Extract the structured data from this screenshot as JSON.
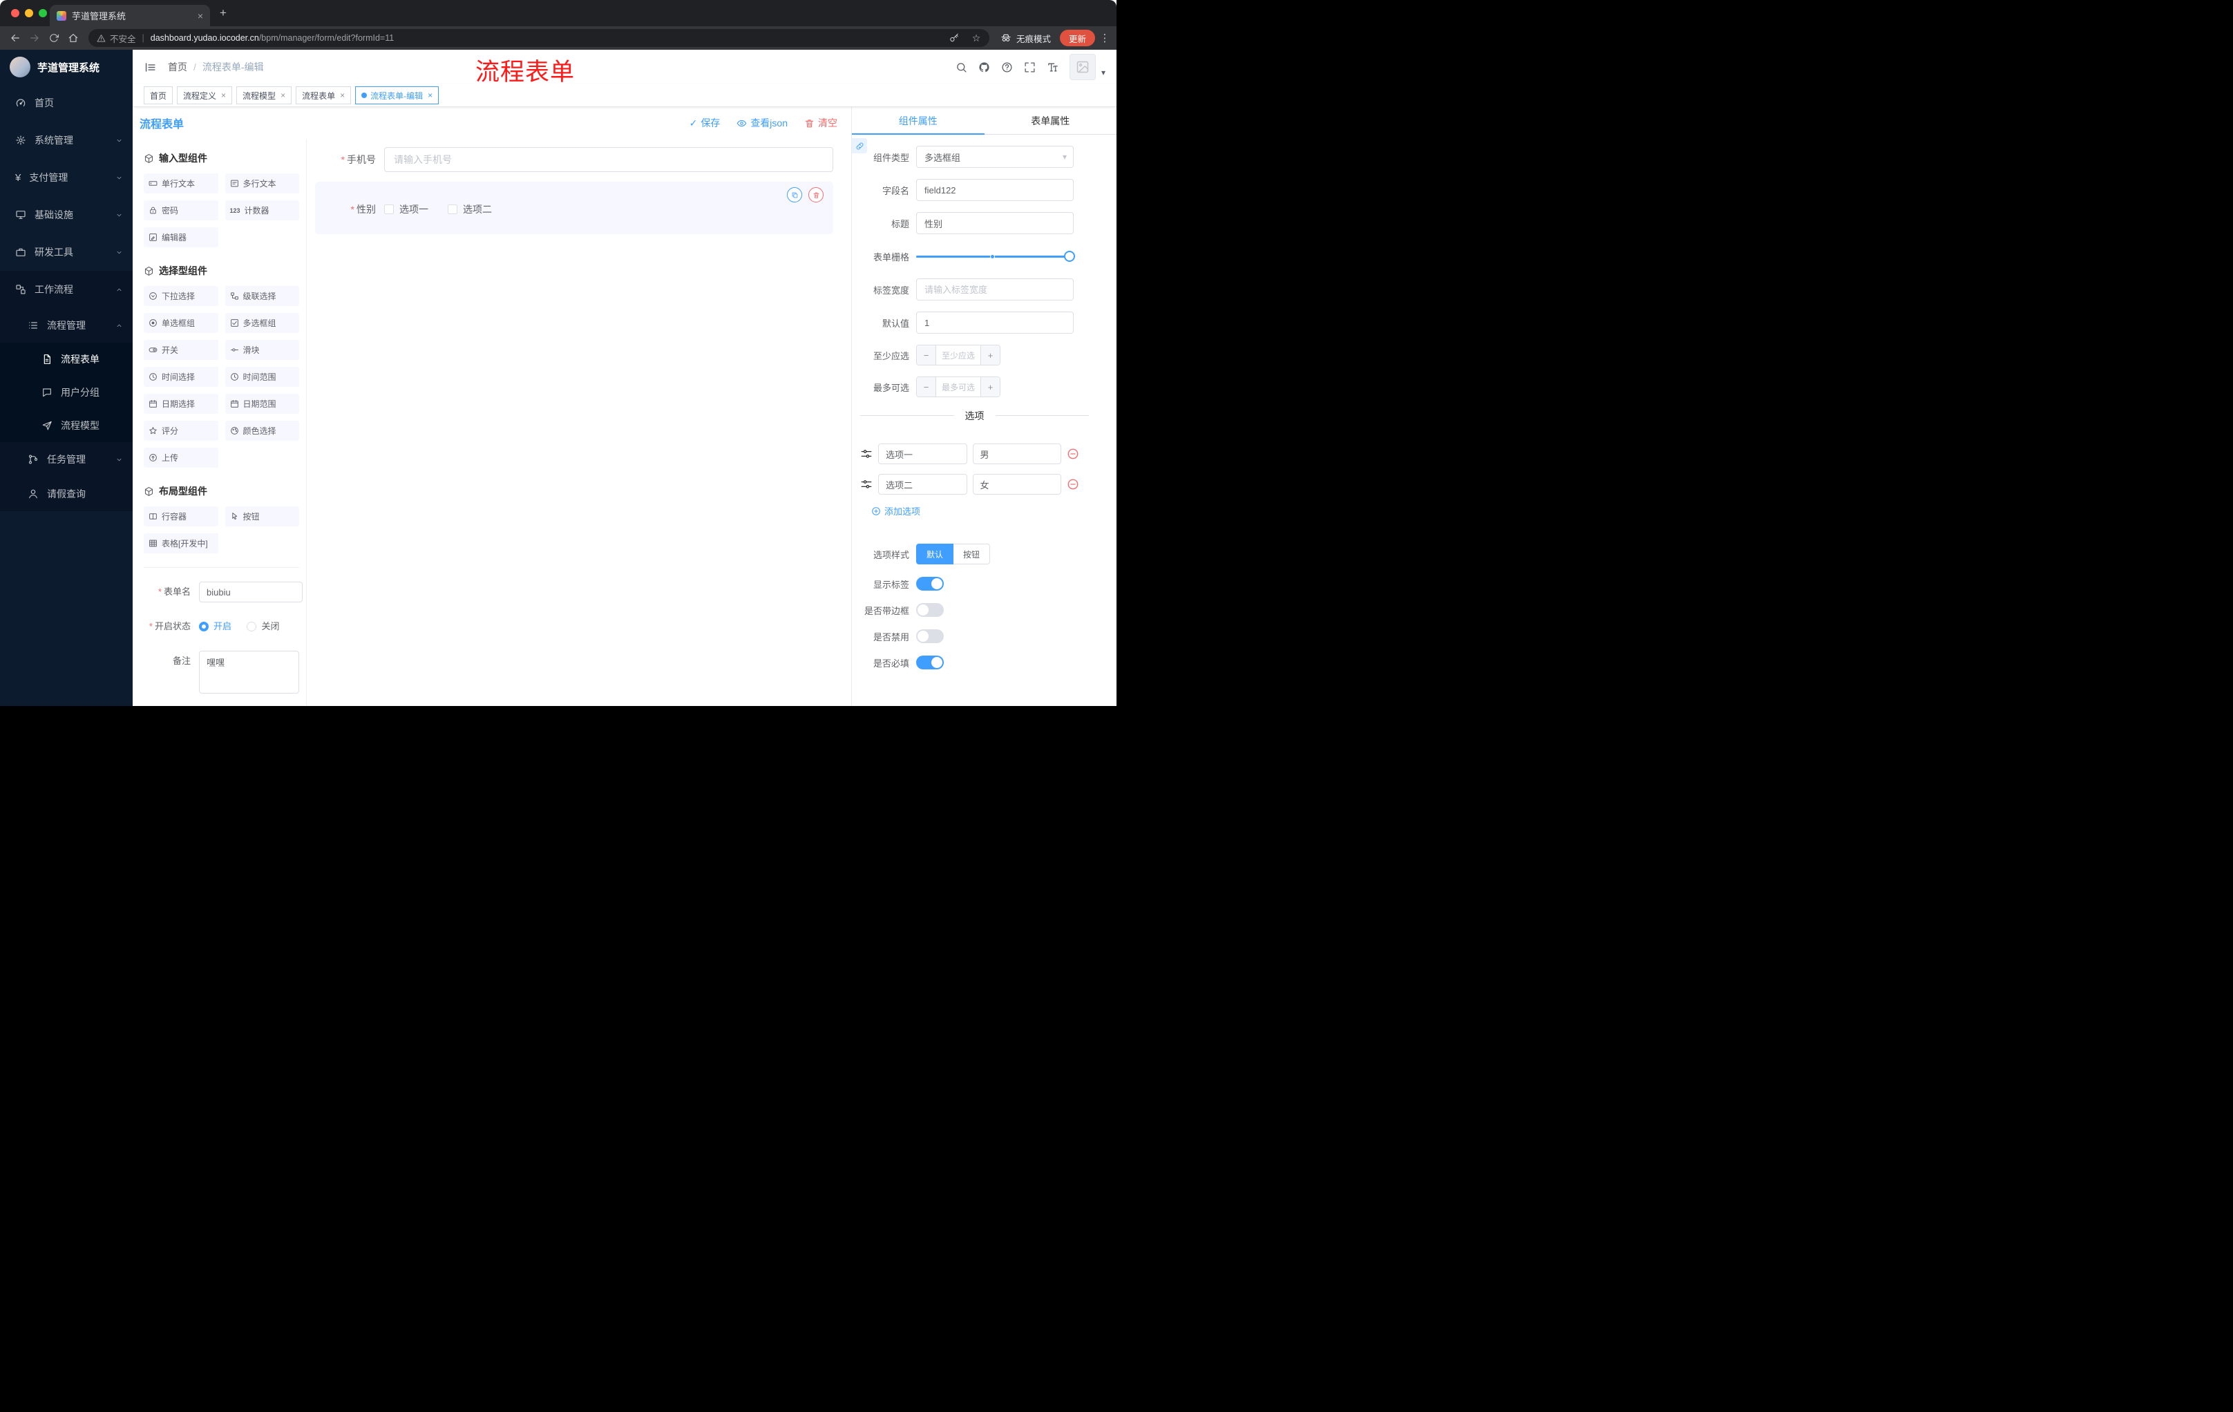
{
  "colors": {
    "accent": "#409eff",
    "danger": "#f56c6c",
    "annotation_red": "#ff1a1a",
    "sidebar_bg": "#0d1b2e"
  },
  "browser": {
    "tab_title": "芋道管理系统",
    "security_label": "不安全",
    "url_separator": "|",
    "url_domain": "dashboard.yudao.iocoder.cn",
    "url_path": "/bpm/manager/form/edit?formId=11",
    "incognito_label": "无痕模式",
    "update_label": "更新"
  },
  "annotation": "流程表单",
  "sidebar": {
    "logo_title": "芋道管理系统",
    "items": [
      {
        "label": "首页"
      },
      {
        "label": "系统管理"
      },
      {
        "label": "支付管理"
      },
      {
        "label": "基础设施"
      },
      {
        "label": "研发工具"
      },
      {
        "label": "工作流程"
      }
    ],
    "workflow": {
      "process_management": "流程管理",
      "children": [
        "流程表单",
        "用户分组",
        "流程模型"
      ],
      "task_management": "任务管理",
      "leave_query": "请假查询"
    }
  },
  "navbar": {
    "breadcrumb_home": "首页",
    "breadcrumb_separator": "/",
    "breadcrumb_current": "流程表单-编辑"
  },
  "tags": [
    {
      "label": "首页"
    },
    {
      "label": "流程定义"
    },
    {
      "label": "流程模型"
    },
    {
      "label": "流程表单"
    },
    {
      "label": "流程表单-编辑"
    }
  ],
  "editor": {
    "title": "流程表单",
    "save": "保存",
    "view_json": "查看json",
    "clear": "清空"
  },
  "palette": {
    "sections": [
      {
        "title": "输入型组件",
        "items": [
          {
            "label": "单行文本"
          },
          {
            "label": "多行文本"
          },
          {
            "label": "密码"
          },
          {
            "label": "计数器"
          },
          {
            "label": "编辑器"
          }
        ]
      },
      {
        "title": "选择型组件",
        "items": [
          {
            "label": "下拉选择"
          },
          {
            "label": "级联选择"
          },
          {
            "label": "单选框组"
          },
          {
            "label": "多选框组"
          },
          {
            "label": "开关"
          },
          {
            "label": "滑块"
          },
          {
            "label": "时间选择"
          },
          {
            "label": "时间范围"
          },
          {
            "label": "日期选择"
          },
          {
            "label": "日期范围"
          },
          {
            "label": "评分"
          },
          {
            "label": "颜色选择"
          },
          {
            "label": "上传"
          }
        ]
      },
      {
        "title": "布局型组件",
        "items": [
          {
            "label": "行容器"
          },
          {
            "label": "按钮"
          },
          {
            "label": "表格[开发中]"
          }
        ]
      }
    ],
    "form": {
      "name_label": "表单名",
      "name_value": "biubiu",
      "status_label": "开启状态",
      "status_on": "开启",
      "status_off": "关闭",
      "remark_label": "备注",
      "remark_value": "嘿嘿"
    }
  },
  "canvas": {
    "phone_label": "手机号",
    "phone_placeholder": "请输入手机号",
    "gender_label": "性别",
    "gender_options": [
      "选项一",
      "选项二"
    ]
  },
  "props": {
    "tab_component": "组件属性",
    "tab_form": "表单属性",
    "component_type_label": "组件类型",
    "component_type_value": "多选框组",
    "field_name_label": "字段名",
    "field_name_value": "field122",
    "title_label": "标题",
    "title_value": "性别",
    "grid_label": "表单栅格",
    "label_width_label": "标签宽度",
    "label_width_placeholder": "请输入标签宽度",
    "default_label": "默认值",
    "default_value": "1",
    "min_label": "至少应选",
    "min_placeholder": "至少应选",
    "max_label": "最多可选",
    "max_placeholder": "最多可选",
    "options_title": "选项",
    "options": [
      {
        "label": "选项一",
        "value": "男"
      },
      {
        "label": "选项二",
        "value": "女"
      }
    ],
    "add_option": "添加选项",
    "style_label": "选项样式",
    "style_default": "默认",
    "style_button": "按钮",
    "toggles": [
      {
        "label": "显示标签",
        "on": true
      },
      {
        "label": "是否带边框",
        "on": false
      },
      {
        "label": "是否禁用",
        "on": false
      },
      {
        "label": "是否必填",
        "on": true
      }
    ]
  },
  "icons": {
    "asterisk_glyph": "*",
    "counter_glyph": "123",
    "yen_glyph": "¥",
    "star_glyph": "☆",
    "dots_glyph": "⋮",
    "caret_glyph": "▾",
    "plus_glyph": "+",
    "close_glyph": "×",
    "check_glyph": "✓",
    "minus_glyph": "−"
  }
}
